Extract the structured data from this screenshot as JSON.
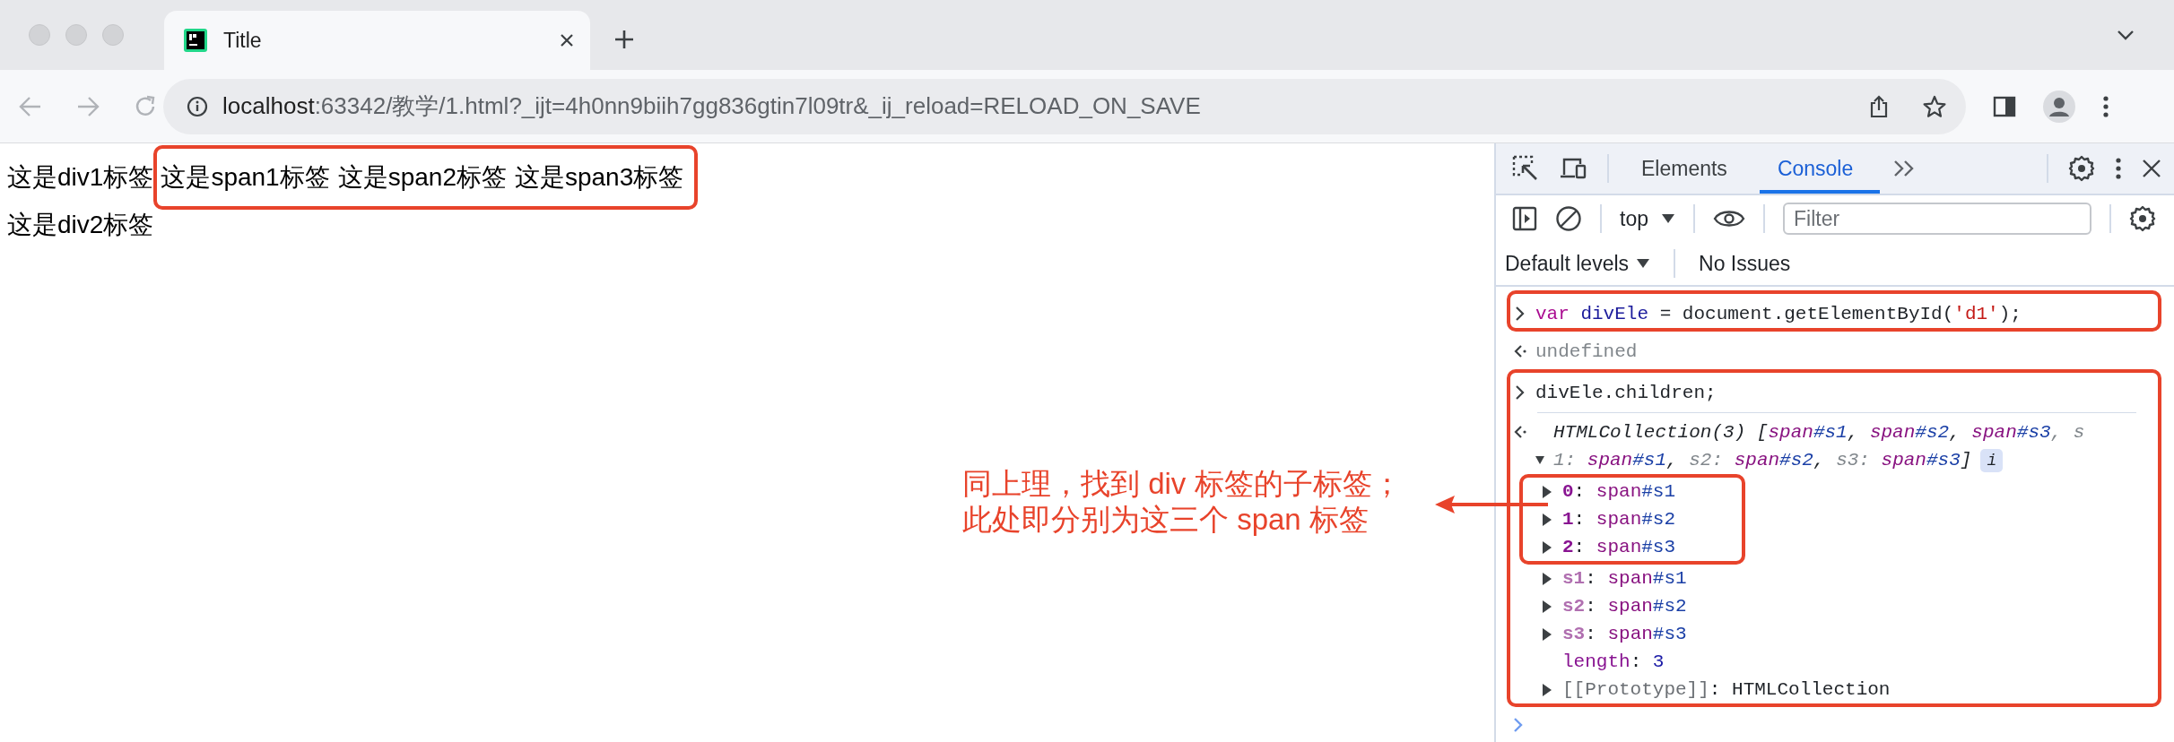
{
  "browser": {
    "tabs": [
      {
        "label": "Title",
        "selected": true
      }
    ],
    "address": {
      "host": "localhost",
      "rest": ":63342/教学/1.html?_ijt=4h0nn9biih7gg836gtin7l09tr&_ij_reload=RELOAD_ON_SAVE"
    }
  },
  "page": {
    "div1": {
      "text": "这是div1标签",
      "spans": [
        "这是span1标签",
        "这是span2标签",
        "这是span3标签"
      ],
      "highlighted": true
    },
    "div2": "这是div2标签"
  },
  "devtools": {
    "tabs": [
      {
        "label": "Elements",
        "selected": false
      },
      {
        "label": "Console",
        "selected": true
      }
    ],
    "context": "top",
    "filter": {
      "placeholder": "Filter"
    },
    "levels": "Default levels",
    "issues": "No Issues",
    "entries": [
      {
        "highlighted": true,
        "lines": [
          {
            "kind": "input",
            "tokens": [
              {
                "t": "var",
                "kind": "keyword"
              },
              {
                "t": " divEle",
                "kind": "variable"
              },
              {
                "t": " = document.getElementById(",
                "kind": "plain"
              },
              {
                "t": "'d1'",
                "kind": "string"
              },
              {
                "t": ");",
                "kind": "plain"
              }
            ]
          }
        ]
      },
      {
        "highlighted": false,
        "lines": [
          {
            "kind": "output",
            "tokens": [
              {
                "t": "undefined",
                "kind": "muted"
              }
            ]
          }
        ]
      },
      {
        "highlighted": true,
        "lines": [
          {
            "kind": "input",
            "tokens": [
              {
                "t": "divEle.children;",
                "kind": "plain"
              }
            ]
          },
          {
            "kind": "collection",
            "expanded": true,
            "summary": [
              [
                {
                  "t": "HTMLCollection(3) [",
                  "kind": "plain"
                },
                {
                  "t": "span",
                  "kind": "tag"
                },
                {
                  "t": "#s1",
                  "kind": "id"
                },
                {
                  "t": ", ",
                  "kind": "plain"
                },
                {
                  "t": "span",
                  "kind": "tag"
                },
                {
                  "t": "#s2",
                  "kind": "id"
                },
                {
                  "t": ", ",
                  "kind": "plain"
                },
                {
                  "t": "span",
                  "kind": "tag"
                },
                {
                  "t": "#s3",
                  "kind": "id"
                },
                {
                  "t": ", s",
                  "kind": "muted"
                }
              ],
              [
                {
                  "t": "1: ",
                  "kind": "muted"
                },
                {
                  "t": "span",
                  "kind": "tag"
                },
                {
                  "t": "#s1",
                  "kind": "id"
                },
                {
                  "t": ", ",
                  "kind": "plain"
                },
                {
                  "t": "s2: ",
                  "kind": "muted"
                },
                {
                  "t": "span",
                  "kind": "tag"
                },
                {
                  "t": "#s2",
                  "kind": "id"
                },
                {
                  "t": ", ",
                  "kind": "plain"
                },
                {
                  "t": "s3: ",
                  "kind": "muted"
                },
                {
                  "t": "span",
                  "kind": "tag"
                },
                {
                  "t": "#s3",
                  "kind": "id"
                },
                {
                  "t": "]",
                  "kind": "plain"
                }
              ]
            ],
            "info": "i",
            "props": [
              {
                "key": "0",
                "kind": "index",
                "expandable": true,
                "highlighted": true,
                "value": [
                  {
                    "t": ": ",
                    "kind": "plain"
                  },
                  {
                    "t": "span",
                    "kind": "tag"
                  },
                  {
                    "t": "#s1",
                    "kind": "id"
                  }
                ]
              },
              {
                "key": "1",
                "kind": "index",
                "expandable": true,
                "highlighted": true,
                "value": [
                  {
                    "t": ": ",
                    "kind": "plain"
                  },
                  {
                    "t": "span",
                    "kind": "tag"
                  },
                  {
                    "t": "#s2",
                    "kind": "id"
                  }
                ]
              },
              {
                "key": "2",
                "kind": "index",
                "expandable": true,
                "highlighted": true,
                "value": [
                  {
                    "t": ": ",
                    "kind": "plain"
                  },
                  {
                    "t": "span",
                    "kind": "tag"
                  },
                  {
                    "t": "#s3",
                    "kind": "id"
                  }
                ]
              },
              {
                "key": "s1",
                "kind": "named",
                "expandable": true,
                "highlighted": false,
                "value": [
                  {
                    "t": ": ",
                    "kind": "plain"
                  },
                  {
                    "t": "span",
                    "kind": "tag"
                  },
                  {
                    "t": "#s1",
                    "kind": "id"
                  }
                ]
              },
              {
                "key": "s2",
                "kind": "named",
                "expandable": true,
                "highlighted": false,
                "value": [
                  {
                    "t": ": ",
                    "kind": "plain"
                  },
                  {
                    "t": "span",
                    "kind": "tag"
                  },
                  {
                    "t": "#s2",
                    "kind": "id"
                  }
                ]
              },
              {
                "key": "s3",
                "kind": "named",
                "expandable": true,
                "highlighted": false,
                "value": [
                  {
                    "t": ": ",
                    "kind": "plain"
                  },
                  {
                    "t": "span",
                    "kind": "tag"
                  },
                  {
                    "t": "#s3",
                    "kind": "id"
                  }
                ]
              },
              {
                "key": "length",
                "kind": "plain",
                "expandable": false,
                "highlighted": false,
                "value": [
                  {
                    "t": ": ",
                    "kind": "plain"
                  },
                  {
                    "t": "3",
                    "kind": "number"
                  }
                ]
              },
              {
                "key": "[[Prototype]]",
                "kind": "internal",
                "expandable": true,
                "highlighted": false,
                "value": [
                  {
                    "t": ": ",
                    "kind": "plain"
                  },
                  {
                    "t": "HTMLCollection",
                    "kind": "plain"
                  }
                ]
              }
            ]
          }
        ]
      }
    ]
  },
  "annotation": {
    "lines": [
      "同上理，找到 div 标签的子标签；",
      "此处即分别为这三个 span 标签"
    ]
  }
}
